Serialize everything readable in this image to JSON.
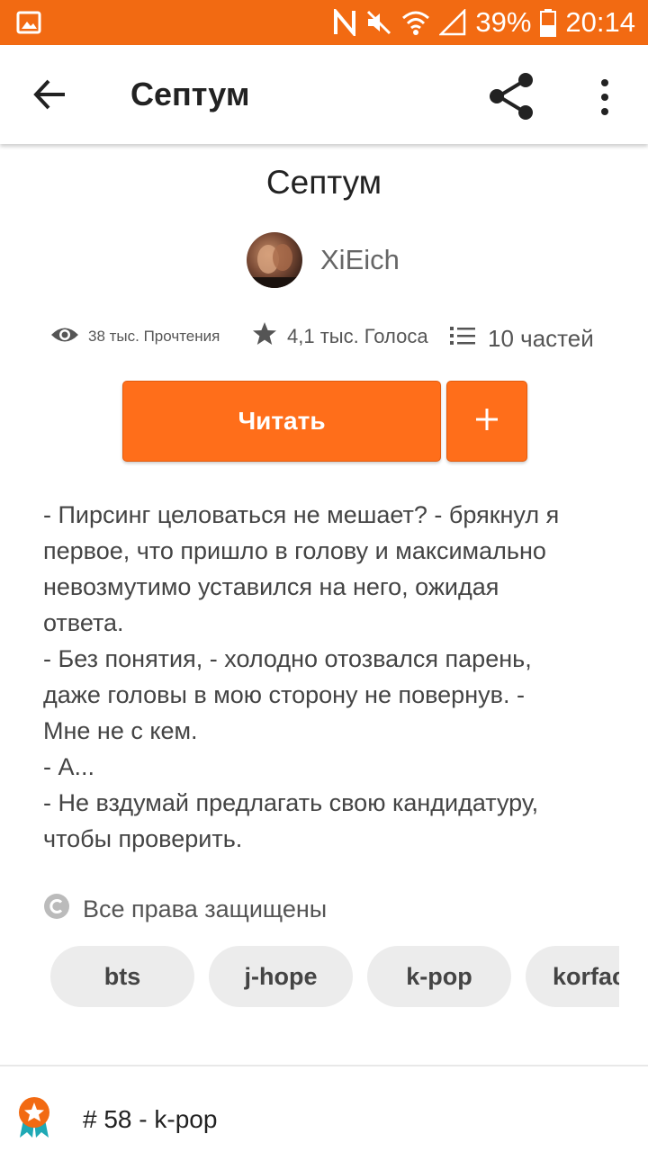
{
  "status_bar": {
    "battery": "39%",
    "time": "20:14",
    "color": "#f26a12"
  },
  "app_bar": {
    "title": "Септум",
    "icons": [
      "back-arrow-icon",
      "share-icon",
      "more-vert-icon"
    ]
  },
  "story": {
    "title": "Септум",
    "author": "XiEich",
    "stats": {
      "reads": "38 тыс. Прочтения",
      "votes": "4,1 тыс. Голоса",
      "parts": "10 частей"
    },
    "read_button": "Читать",
    "add_button_icon": "plus-icon",
    "accent_color": "#ff6e1a",
    "excerpt_lines": [
      "- Пирсинг целоваться не мешает? - брякнул я",
      "первое, что пришло в голову и максимально",
      "невозмутимо уставился на него, ожидая",
      "ответа.",
      "- Без понятия, - холодно отозвался парень,",
      "даже головы в мою сторону не повернув. -",
      "Мне не с кем.",
      "- А...",
      "- Не вздумай предлагать свою кандидатуру,",
      "чтобы проверить."
    ],
    "copyright": "Все права защищены",
    "tags": [
      "bts",
      "j-hope",
      "k-pop",
      "korfac"
    ],
    "ranking": "# 58 - k-pop"
  }
}
